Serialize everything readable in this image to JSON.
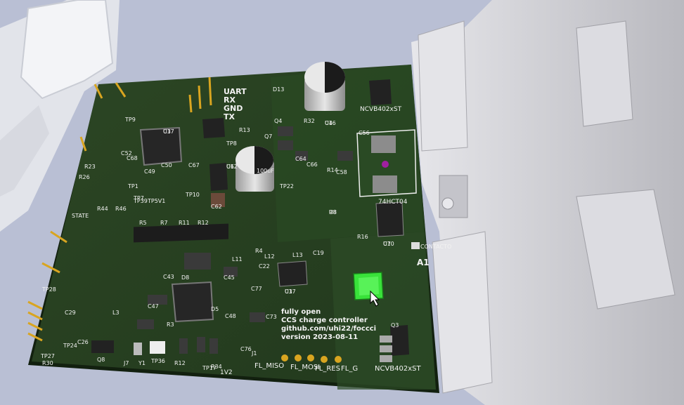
{
  "colors": {
    "background": "#b9bfd4",
    "board": "#2f4a27",
    "board_dark": "#243c1f",
    "silkscreen": "#f2f2f2",
    "connector": "#d4d4d8",
    "highlight": "#39e23a"
  },
  "silkscreen": {
    "uart": [
      "UART",
      "RX",
      "GND",
      "TX"
    ],
    "about": [
      "fully open",
      "CCS charge controller",
      "github.com/uhi22/foccci",
      "version 2023-08-11"
    ],
    "regulator_top": "NCVB402xST",
    "regulator_bottom": "NCVB402xST",
    "logic_chip": "74HCT04",
    "contactor": "CONTACTO",
    "cap_label": "100uF",
    "connector_id": "A1",
    "state": "STATE",
    "fl_labels": [
      "FL_MISO",
      "FL_MOSI",
      "FL_RES",
      "FL_G"
    ],
    "power_label": "1V2",
    "refs": [
      "U1",
      "U3",
      "U4",
      "U6",
      "U7",
      "U8",
      "Q3",
      "Q4",
      "Q7",
      "Q8",
      "D5",
      "D8",
      "D13",
      "L3",
      "L11",
      "L12",
      "L13",
      "C19",
      "C22",
      "C43",
      "C45",
      "C47",
      "C48",
      "C49",
      "C50",
      "C52",
      "C56",
      "C58",
      "C62",
      "C64",
      "C66",
      "C67",
      "C68",
      "C73",
      "C76",
      "C77",
      "R3",
      "R4",
      "R5",
      "R7",
      "R11",
      "R12",
      "R13",
      "R14",
      "R16",
      "R23",
      "R26",
      "R30",
      "R32",
      "R34",
      "R44",
      "R46",
      "TP1",
      "TP7",
      "TP8",
      "TP9",
      "TP10",
      "TP22",
      "TP27",
      "TP28",
      "TP36",
      "TP39",
      "TP5V1",
      "J1",
      "J7",
      "Y1",
      "R12",
      "TP17",
      "TP24",
      "C26",
      "C29",
      "C37",
      "C17",
      "C16",
      "C12",
      "C10",
      "R8"
    ]
  }
}
